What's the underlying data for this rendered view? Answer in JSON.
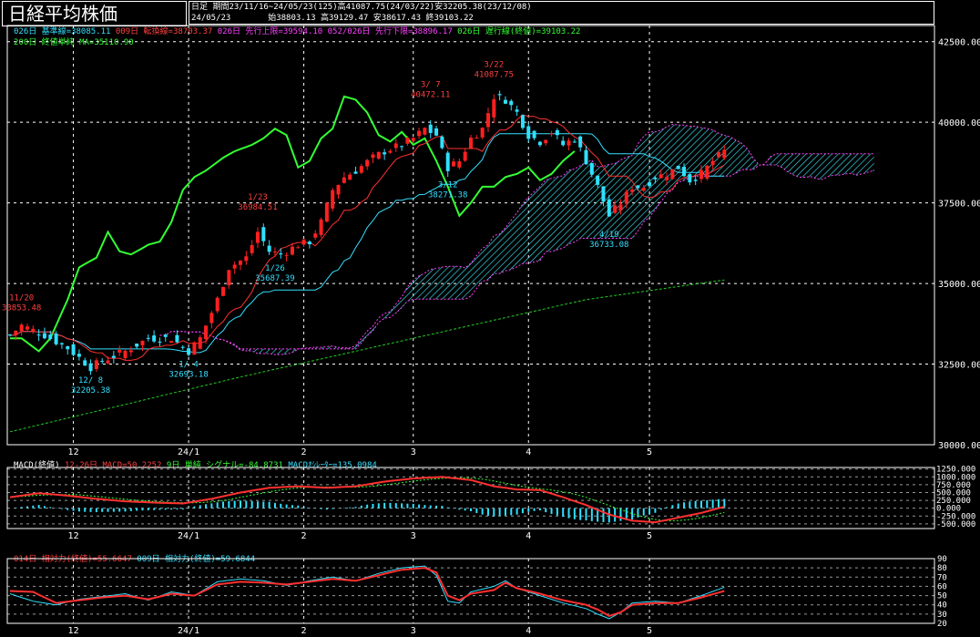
{
  "header": {
    "title": "日経平均株価",
    "period_label": "日足",
    "period_info": "期間23/11/16~24/05/23(125)高41087.75(24/03/22)安32205.38(23/12/08)",
    "daily_info_date": "24/05/23",
    "daily_info_values": "始38803.13 高39129.47 安38617.43 終39103.22"
  },
  "main_legend": [
    {
      "text": "026日 基準線=38085.11",
      "color": "#33e0ff"
    },
    {
      "text": "009日 転換線=38703.37",
      "color": "#ff4040"
    },
    {
      "text": "026日 先行上限=39594.10",
      "color": "#ff40ff"
    },
    {
      "text": "052/026日 先行下限=38896.17",
      "color": "#ff40ff"
    },
    {
      "text": "026日 遅行線(終値)=39103.22",
      "color": "#33ff33"
    },
    {
      "text": "200日 終値単純 MA=35110.90",
      "color": "#33ff33"
    }
  ],
  "colors": {
    "up_candle": "#ff2020",
    "down_candle": "#30e0ff",
    "kijun": "#33e0ff",
    "tenkan": "#ff3030",
    "span_a": "#ff40ff",
    "span_b": "#ff40ff",
    "cloud_hatch": "#40f0ff",
    "chikou": "#33ff33",
    "ma200": "#22cc22",
    "grid": "#ffffff"
  },
  "x_axis": {
    "ticks": [
      {
        "label": "12",
        "index": 11
      },
      {
        "label": "24/1",
        "index": 31
      },
      {
        "label": "2",
        "index": 51
      },
      {
        "label": "3",
        "index": 70
      },
      {
        "label": "4",
        "index": 90
      },
      {
        "label": "5",
        "index": 111
      }
    ]
  },
  "main_axis": {
    "ylim": [
      30000,
      43000
    ],
    "ticks": [
      "42500.00",
      "40000.00",
      "37500.00",
      "35000.00",
      "32500.00",
      "30000.00"
    ],
    "tick_values": [
      42500,
      40000,
      37500,
      35000,
      32500,
      30000
    ]
  },
  "annotations": [
    {
      "date": "11/20",
      "value": "33853.48",
      "index": 2,
      "price": 33853.48,
      "color": "#ff4040",
      "pos": "above"
    },
    {
      "date": "12/ 8",
      "value": "32205.38",
      "index": 14,
      "price": 32205.38,
      "color": "#33e0ff",
      "pos": "below"
    },
    {
      "date": "1/ 4",
      "value": "32693.18",
      "index": 31,
      "price": 32693.18,
      "color": "#33e0ff",
      "pos": "below"
    },
    {
      "date": "1/23",
      "value": "36984.51",
      "index": 43,
      "price": 36984.51,
      "color": "#ff4040",
      "pos": "above"
    },
    {
      "date": "1/26",
      "value": "35687.39",
      "index": 46,
      "price": 35687.39,
      "color": "#33e0ff",
      "pos": "below"
    },
    {
      "date": "3/ 7",
      "value": "40472.11",
      "index": 73,
      "price": 40472.11,
      "color": "#ff4040",
      "pos": "above"
    },
    {
      "date": "3/12",
      "value": "38271.38",
      "index": 76,
      "price": 38271.38,
      "color": "#33e0ff",
      "pos": "below"
    },
    {
      "date": "3/22",
      "value": "41087.75",
      "index": 84,
      "price": 41087.75,
      "color": "#ff4040",
      "pos": "above"
    },
    {
      "date": "4/19",
      "value": "36733.08",
      "index": 104,
      "price": 36733.08,
      "color": "#33e0ff",
      "pos": "below"
    }
  ],
  "macd": {
    "legend": [
      {
        "text": "MACD(終値)",
        "color": "#ffffff"
      },
      {
        "text": "12-26日 MACD=50.2252",
        "color": "#ff4040"
      },
      {
        "text": "9日 単純 シグナル=-84.8731",
        "color": "#33ff33"
      },
      {
        "text": "MACDｵｼﾚｰﾀｰ=135.0984",
        "color": "#33e0ff"
      }
    ],
    "ylim": [
      -650,
      1300
    ],
    "ticks": [
      "1250.000",
      "1000.000",
      "750.000",
      "500.000",
      "250.000",
      "0.000",
      "-250.000",
      "-500.000"
    ],
    "tick_values": [
      1250,
      1000,
      750,
      500,
      250,
      0,
      -250,
      -500
    ]
  },
  "rsi": {
    "legend": [
      {
        "text": "014日 相対力(終値)=55.6647",
        "color": "#ff4040"
      },
      {
        "text": "009日 相対力(終値)=59.6844",
        "color": "#33e0ff"
      }
    ],
    "ylim": [
      20,
      90
    ],
    "ticks": [
      "90",
      "80",
      "70",
      "60",
      "50",
      "40",
      "30",
      "20"
    ],
    "tick_values": [
      90,
      80,
      70,
      60,
      50,
      40,
      30,
      20
    ]
  },
  "chart_data": {
    "type": "candlestick",
    "title": "日経平均株価",
    "period": "23/11/16~24/05/23",
    "bars": 125,
    "high": 41087.75,
    "high_date": "24/03/22",
    "low": 32205.38,
    "low_date": "23/12/08",
    "close_keypoints": [
      [
        0,
        33400
      ],
      [
        2,
        33700
      ],
      [
        6,
        33400
      ],
      [
        10,
        33000
      ],
      [
        14,
        32400
      ],
      [
        16,
        32600
      ],
      [
        20,
        32900
      ],
      [
        24,
        33300
      ],
      [
        28,
        33300
      ],
      [
        31,
        32900
      ],
      [
        33,
        33300
      ],
      [
        36,
        34500
      ],
      [
        38,
        35500
      ],
      [
        41,
        35800
      ],
      [
        43,
        36600
      ],
      [
        45,
        36000
      ],
      [
        47,
        35900
      ],
      [
        50,
        36200
      ],
      [
        52,
        36300
      ],
      [
        54,
        36900
      ],
      [
        56,
        37900
      ],
      [
        58,
        38300
      ],
      [
        60,
        38500
      ],
      [
        63,
        38900
      ],
      [
        65,
        39100
      ],
      [
        68,
        39300
      ],
      [
        70,
        39500
      ],
      [
        72,
        39800
      ],
      [
        74,
        39600
      ],
      [
        76,
        38600
      ],
      [
        78,
        38800
      ],
      [
        80,
        39500
      ],
      [
        82,
        39800
      ],
      [
        84,
        40800
      ],
      [
        86,
        40700
      ],
      [
        88,
        40300
      ],
      [
        90,
        39600
      ],
      [
        92,
        39400
      ],
      [
        94,
        39700
      ],
      [
        96,
        39300
      ],
      [
        98,
        39500
      ],
      [
        100,
        38800
      ],
      [
        102,
        38000
      ],
      [
        104,
        37100
      ],
      [
        106,
        37500
      ],
      [
        108,
        38000
      ],
      [
        110,
        38000
      ],
      [
        112,
        38300
      ],
      [
        114,
        38400
      ],
      [
        116,
        38600
      ],
      [
        118,
        38200
      ],
      [
        120,
        38400
      ],
      [
        122,
        38800
      ],
      [
        124,
        39103
      ]
    ],
    "ma200_keypoints": [
      [
        0,
        30400
      ],
      [
        40,
        32100
      ],
      [
        70,
        33300
      ],
      [
        100,
        34500
      ],
      [
        124,
        35110
      ]
    ],
    "macd_keypoints": [
      [
        0,
        350
      ],
      [
        5,
        480
      ],
      [
        10,
        400
      ],
      [
        15,
        300
      ],
      [
        20,
        220
      ],
      [
        25,
        180
      ],
      [
        30,
        150
      ],
      [
        35,
        300
      ],
      [
        40,
        500
      ],
      [
        45,
        650
      ],
      [
        50,
        700
      ],
      [
        55,
        650
      ],
      [
        60,
        700
      ],
      [
        65,
        850
      ],
      [
        70,
        950
      ],
      [
        75,
        1000
      ],
      [
        80,
        900
      ],
      [
        84,
        700
      ],
      [
        88,
        600
      ],
      [
        92,
        580
      ],
      [
        96,
        350
      ],
      [
        100,
        100
      ],
      [
        104,
        -200
      ],
      [
        108,
        -400
      ],
      [
        112,
        -450
      ],
      [
        116,
        -300
      ],
      [
        120,
        -150
      ],
      [
        124,
        50
      ]
    ],
    "rsi14_keypoints": [
      [
        0,
        55
      ],
      [
        4,
        54
      ],
      [
        8,
        42
      ],
      [
        12,
        45
      ],
      [
        16,
        48
      ],
      [
        20,
        50
      ],
      [
        24,
        46
      ],
      [
        28,
        52
      ],
      [
        32,
        50
      ],
      [
        36,
        62
      ],
      [
        40,
        65
      ],
      [
        44,
        64
      ],
      [
        48,
        62
      ],
      [
        52,
        65
      ],
      [
        56,
        68
      ],
      [
        60,
        66
      ],
      [
        64,
        72
      ],
      [
        68,
        78
      ],
      [
        72,
        80
      ],
      [
        74,
        75
      ],
      [
        76,
        50
      ],
      [
        78,
        45
      ],
      [
        80,
        52
      ],
      [
        84,
        56
      ],
      [
        86,
        64
      ],
      [
        88,
        58
      ],
      [
        92,
        52
      ],
      [
        96,
        45
      ],
      [
        100,
        40
      ],
      [
        102,
        35
      ],
      [
        104,
        28
      ],
      [
        106,
        32
      ],
      [
        108,
        40
      ],
      [
        112,
        42
      ],
      [
        116,
        42
      ],
      [
        120,
        48
      ],
      [
        124,
        55
      ]
    ],
    "rsi9_keypoints": [
      [
        0,
        52
      ],
      [
        4,
        44
      ],
      [
        8,
        40
      ],
      [
        12,
        46
      ],
      [
        16,
        49
      ],
      [
        20,
        52
      ],
      [
        24,
        45
      ],
      [
        28,
        54
      ],
      [
        32,
        50
      ],
      [
        36,
        65
      ],
      [
        40,
        68
      ],
      [
        44,
        66
      ],
      [
        48,
        61
      ],
      [
        52,
        66
      ],
      [
        56,
        70
      ],
      [
        60,
        66
      ],
      [
        64,
        74
      ],
      [
        68,
        80
      ],
      [
        72,
        82
      ],
      [
        74,
        72
      ],
      [
        76,
        44
      ],
      [
        78,
        42
      ],
      [
        80,
        54
      ],
      [
        84,
        60
      ],
      [
        86,
        66
      ],
      [
        88,
        58
      ],
      [
        92,
        50
      ],
      [
        96,
        42
      ],
      [
        100,
        36
      ],
      [
        102,
        30
      ],
      [
        104,
        25
      ],
      [
        106,
        32
      ],
      [
        108,
        42
      ],
      [
        112,
        44
      ],
      [
        116,
        42
      ],
      [
        120,
        50
      ],
      [
        124,
        59
      ]
    ]
  }
}
